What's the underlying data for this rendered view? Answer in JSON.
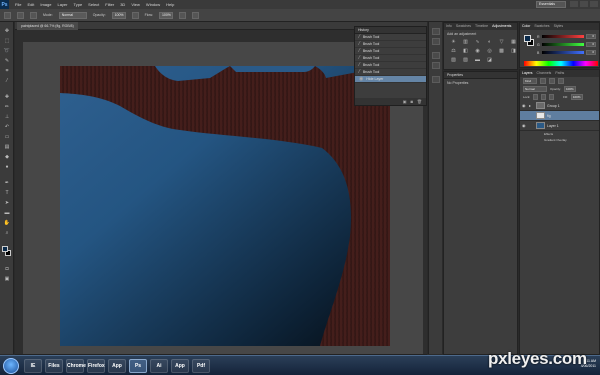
{
  "app": {
    "logo": "Ps",
    "menu": [
      "File",
      "Edit",
      "Image",
      "Layer",
      "Type",
      "Select",
      "Filter",
      "3D",
      "View",
      "Window",
      "Help"
    ],
    "workspace": "Essentials"
  },
  "options_bar": {
    "mode_label": "Mode:",
    "mode_value": "Normal",
    "opacity_label": "Opacity:",
    "opacity_value": "100%",
    "flow_label": "Flow:",
    "flow_value": "100%"
  },
  "document": {
    "tab_title": "paintplaced @ 66.7% (fig, RGB/8)",
    "zoom": "66.67%",
    "doc_size": "Doc: 2.64M/42.7M"
  },
  "history_panel": {
    "tab": "History",
    "items": [
      "Brush Tool",
      "Brush Tool",
      "Brush Tool",
      "Brush Tool",
      "Brush Tool",
      "Brush Tool",
      "Hide Layer"
    ],
    "active_index": 6
  },
  "adjustments_panel": {
    "tabs": [
      "Info",
      "Swatches",
      "Timeline",
      "Adjustments"
    ],
    "active_tab": "Adjustments",
    "title": "Add an adjustment"
  },
  "properties_panel": {
    "tab": "Properties",
    "title": "No Properties"
  },
  "color_panel": {
    "tabs": [
      "Color",
      "Swatches",
      "Styles"
    ],
    "active_tab": "Color",
    "channels": [
      {
        "label": "R",
        "value": "0",
        "gradient": "#ff4040"
      },
      {
        "label": "G",
        "value": "0",
        "gradient": "#40ff40"
      },
      {
        "label": "B",
        "value": "0",
        "gradient": "#4070ff"
      }
    ]
  },
  "layers_panel": {
    "tabs": [
      "Layers",
      "Channels",
      "Paths"
    ],
    "active_tab": "Layers",
    "blend_mode": "Normal",
    "opacity_label": "Opacity:",
    "opacity_value": "100%",
    "fill_label": "Fill:",
    "fill_value": "100%",
    "layers": [
      {
        "name": "Group 1",
        "selected": false
      },
      {
        "name": "fig",
        "selected": true
      },
      {
        "name": "Layer 1",
        "selected": false
      }
    ],
    "effects": [
      "Effects",
      "Gradient Overlay"
    ]
  },
  "taskbar": {
    "apps": [
      "IE",
      "Files",
      "Chrome",
      "Firefox",
      "App",
      "Ps",
      "Ai",
      "App",
      "Pdf"
    ],
    "active_index": 5,
    "time": "6:11 AM",
    "date": "4/06/2011"
  },
  "watermark": "pxleyes.com",
  "colors": {
    "canvas_light": "#2f6090",
    "canvas_dark": "#050b11",
    "tree_bark": "#3a1a18",
    "active_blue": "#5f7ea0"
  }
}
